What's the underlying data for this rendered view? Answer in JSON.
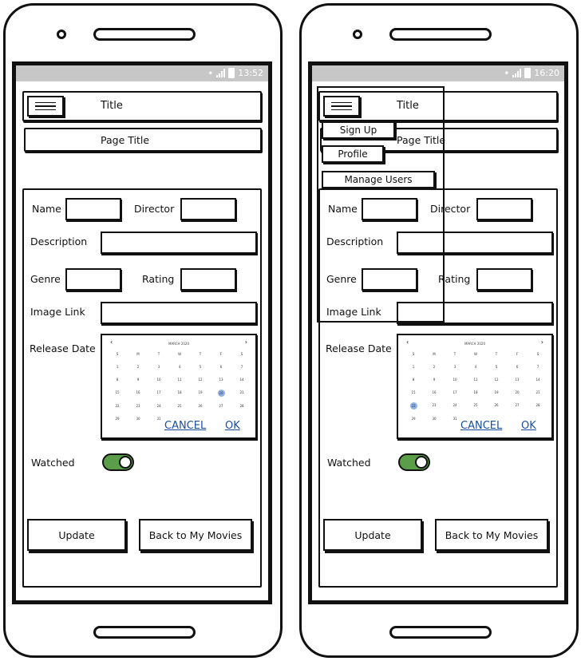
{
  "phones": [
    {
      "status": {
        "time": "13:52"
      },
      "header": {
        "title": "Title"
      },
      "page_title": "Page Title",
      "menu": null
    },
    {
      "status": {
        "time": "16:20"
      },
      "header": {
        "title": "Title"
      },
      "page_title": "Page Title",
      "menu": {
        "items": [
          "Sign Up",
          "Profile",
          "Manage Users"
        ]
      }
    }
  ],
  "form": {
    "name_label": "Name",
    "director_label": "Director",
    "description_label": "Description",
    "genre_label": "Genre",
    "rating_label": "Rating",
    "image_link_label": "Image Link",
    "release_date_label": "Release Date",
    "watched_label": "Watched",
    "watched_on": true,
    "update_label": "Update",
    "back_label": "Back to My Movies"
  },
  "calendar": {
    "month": "MARCH 2020",
    "weekdays": [
      "S",
      "M",
      "T",
      "W",
      "T",
      "F",
      "S"
    ],
    "rows": [
      [
        "1",
        "2",
        "3",
        "4",
        "5",
        "6",
        "7"
      ],
      [
        "8",
        "9",
        "10",
        "11",
        "12",
        "13",
        "14"
      ],
      [
        "15",
        "16",
        "17",
        "18",
        "19",
        "20",
        "21"
      ],
      [
        "22",
        "23",
        "24",
        "25",
        "26",
        "27",
        "28"
      ],
      [
        "29",
        "30",
        "31",
        "",
        "",
        "",
        ""
      ]
    ],
    "selected": [
      "20",
      "22"
    ],
    "cancel_label": "CANCEL",
    "ok_label": "OK"
  },
  "colors": {
    "toggle_on": "#5a9e4a",
    "selected_day": "#8fb2e6",
    "link": "#1a4fa0",
    "statusbar": "#c7c7c7"
  },
  "icons": [
    "wifi-icon",
    "signal-icon",
    "battery-icon",
    "hamburger-icon",
    "chevron-left-icon",
    "chevron-right-icon"
  ]
}
